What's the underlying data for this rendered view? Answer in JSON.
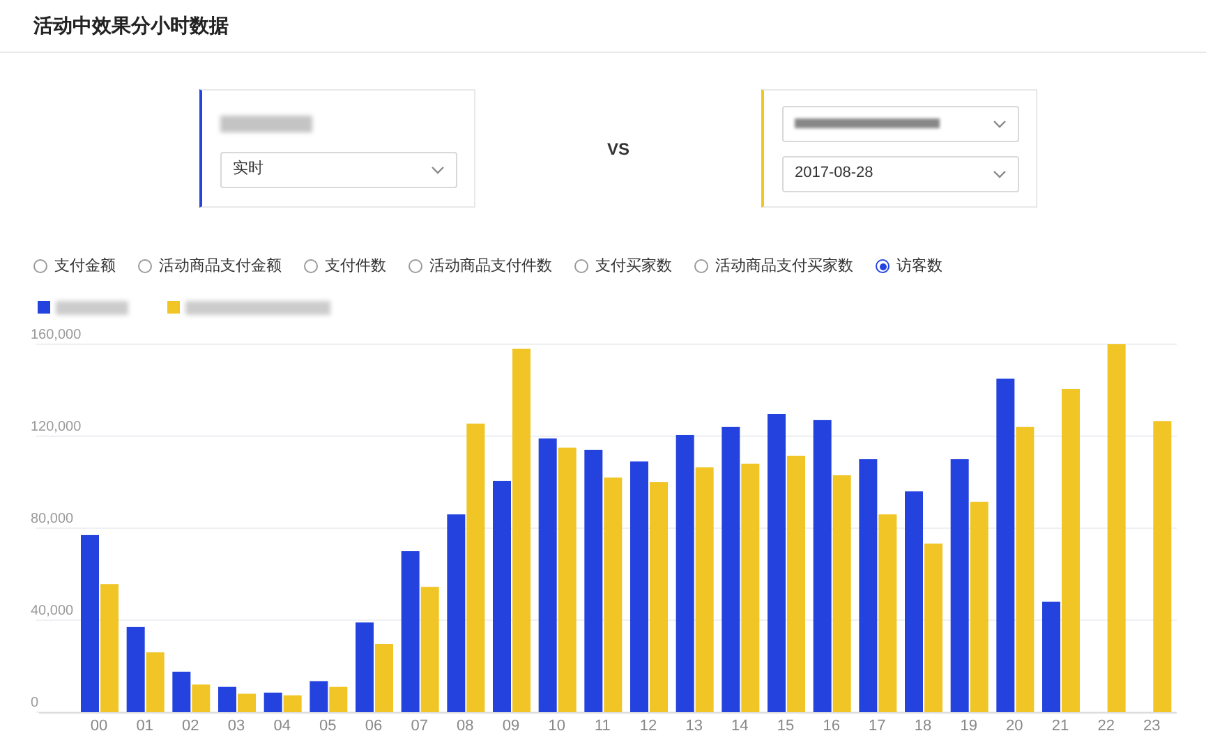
{
  "title": "活动中效果分小时数据",
  "panels": [
    {
      "color": "#2443de",
      "selects": [
        {
          "kind": "blurred"
        },
        {
          "kind": "text",
          "value": "实时"
        }
      ]
    },
    {
      "color": "#f0c525",
      "selects": [
        {
          "kind": "blurred-field"
        },
        {
          "kind": "text",
          "value": "2017-08-28"
        }
      ]
    }
  ],
  "separator": "VS",
  "metrics": [
    {
      "label": "支付金额",
      "selected": false
    },
    {
      "label": "活动商品支付金额",
      "selected": false
    },
    {
      "label": "支付件数",
      "selected": false
    },
    {
      "label": "活动商品支付件数",
      "selected": false
    },
    {
      "label": "支付买家数",
      "selected": false
    },
    {
      "label": "活动商品支付买家数",
      "selected": false
    },
    {
      "label": "访客数",
      "selected": true
    }
  ],
  "chart_data": {
    "type": "bar",
    "categories": [
      "00",
      "01",
      "02",
      "03",
      "04",
      "05",
      "06",
      "07",
      "08",
      "09",
      "10",
      "11",
      "12",
      "13",
      "14",
      "15",
      "16",
      "17",
      "18",
      "19",
      "20",
      "21",
      "22",
      "23"
    ],
    "series": [
      {
        "color": "#2443de",
        "values": [
          77000,
          37000,
          17600,
          11000,
          8500,
          13500,
          39000,
          70000,
          86000,
          100600,
          119000,
          114000,
          109000,
          120600,
          124000,
          129700,
          127000,
          110000,
          96000,
          110000,
          145000,
          48000,
          null,
          null
        ]
      },
      {
        "color": "#f0c525",
        "values": [
          55700,
          26000,
          12000,
          8000,
          7300,
          11000,
          29700,
          54500,
          125500,
          158000,
          115000,
          102000,
          100000,
          106500,
          108000,
          111500,
          103000,
          86000,
          73300,
          91500,
          124000,
          140600,
          160000,
          126600
        ]
      }
    ],
    "ylim": [
      0,
      160000
    ],
    "grid": true,
    "yticks": [
      {
        "value": 0,
        "label": "0"
      },
      {
        "value": 40000,
        "label": "40,000"
      },
      {
        "value": 80000,
        "label": "80,000"
      },
      {
        "value": 120000,
        "label": "120,000"
      },
      {
        "value": 160000,
        "label": "160,000"
      }
    ]
  }
}
